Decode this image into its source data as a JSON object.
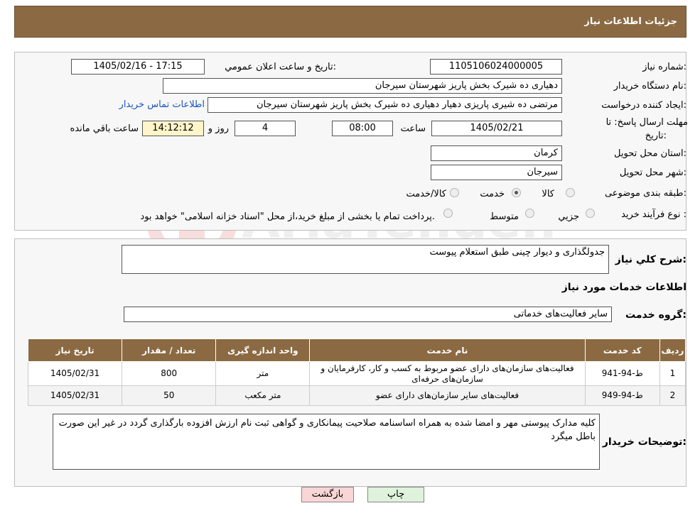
{
  "header": {
    "title": "جزئیات اطلاعات نیاز"
  },
  "fields": {
    "need_number_label": "شماره نیاز:",
    "need_number": "1105106024000005",
    "announce_label": "تاريخ و ساعت اعلان عمومي:",
    "announce_value": "1405/02/16 - 17:15",
    "buyer_org_label": "نام دستگاه خريدار:",
    "buyer_org": "دهیاری ده شیرک بخش پاریز شهرستان سیرجان",
    "creator_label": "ايجاد كننده درخواست:",
    "creator": "مرتضی ده شیری پاریزی دهیار دهیاری ده شیرک بخش پاریز شهرستان سیرجان",
    "contact_link": "اطلاعات تماس خریدار",
    "deadline_label_1": "مهلت ارسال پاسخ: تا",
    "deadline_label_2": "تاريخ:",
    "deadline_date": "1405/02/21",
    "time_label": "ساعت",
    "deadline_time": "08:00",
    "days_value": "4",
    "days_label": "روز و",
    "remaining_time": "14:12:12",
    "remaining_label": "ساعت باقي مانده",
    "province_label": "استان محل تحويل:",
    "province": "کرمان",
    "city_label": "شهر محل تحويل:",
    "city": "سیرجان",
    "category_label": "طبقه بندی موضوعی:",
    "category_options": [
      "کالا",
      "خدمت",
      "کالا/خدمت"
    ],
    "category_selected": "خدمت",
    "process_label": "نوع فرآيند خريد :",
    "process_options": [
      "جزيي",
      "متوسط"
    ],
    "process_note": "پرداخت تمام یا بخشی از مبلغ خرید،از محل \"اسناد خزانه اسلامی\" خواهد بود."
  },
  "summary": {
    "label": "شرح كلي نياز:",
    "value": "جدولگذاری و دیوار چینی طبق استعلام پیوست"
  },
  "services_title": "اطلاعات خدمات مورد نياز",
  "service_group": {
    "label": "گروه خدمت:",
    "value": "سایر فعالیت‌های خدماتی"
  },
  "table": {
    "headers": [
      "رديف",
      "كد خدمت",
      "نام خدمت",
      "واحد اندازه گيری",
      "تعداد / مقدار",
      "تاريخ نياز"
    ],
    "rows": [
      {
        "idx": "1",
        "code": "ط-94-941",
        "name": "فعالیت‌های سازمان‌های دارای عضو مربوط به کسب و کار، کارفرمایان و سازمان‌های حرفه‌ای",
        "unit": "متر",
        "qty": "800",
        "date": "1405/02/31"
      },
      {
        "idx": "2",
        "code": "ط-94-949",
        "name": "فعالیت‌های سایر سازمان‌های دارای عضو",
        "unit": "متر مکعب",
        "qty": "50",
        "date": "1405/02/31"
      }
    ]
  },
  "buyer_notes": {
    "label": "توضيحات خريدار:",
    "value": "کلیه مدارک پیوستی مهر و امضا شده به همراه اساسنامه صلاحیت پیمانکاری و گواهی ثبت نام ارزش افزوده بارگذاری گردد در غیر این صورت باطل میگرد"
  },
  "buttons": {
    "print": "چاپ",
    "back": "بازگشت"
  },
  "watermark": "AriaTender.neT",
  "colors": {
    "header_bg": "#8b6a43",
    "link": "#1a55c4",
    "back_btn_bg": "#f9d6d6",
    "print_btn_bg": "#dff2dc"
  }
}
